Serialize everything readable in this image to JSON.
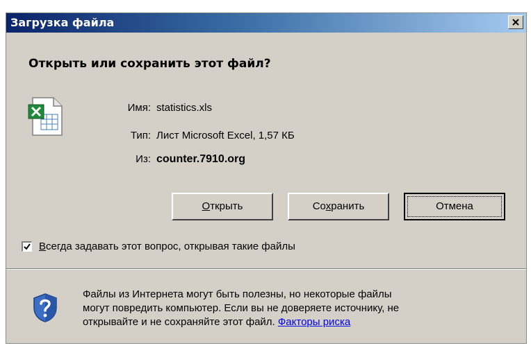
{
  "window": {
    "title": "Загрузка файла",
    "close_label": "Закрыть"
  },
  "heading": "Открыть или сохранить этот файл?",
  "file": {
    "icon": "excel-file-icon",
    "name_label": "Имя:",
    "name_value": "statistics.xls",
    "type_label": "Тип:",
    "type_value": "Лист Microsoft Excel, 1,57 КБ",
    "from_label": "Из:",
    "from_value": "counter.7910.org"
  },
  "buttons": {
    "open": {
      "mnemonic": "О",
      "rest": "ткрыть"
    },
    "save": {
      "before": "Со",
      "mnemonic": "х",
      "after": "ранить"
    },
    "cancel": "Отмена"
  },
  "checkbox": {
    "checked": true,
    "mnemonic": "В",
    "rest": "сегда задавать этот вопрос, открывая такие файлы"
  },
  "warning": {
    "icon": "security-shield-icon",
    "line1": "Файлы из Интернета могут быть полезны, но некоторые файлы",
    "line2": "могут повредить компьютер. Если вы не доверяете источнику, не",
    "line3": "открывайте и не сохраняйте этот файл.",
    "link": "Факторы риска"
  },
  "colors": {
    "dialog_bg": "#d4d0c8",
    "titlebar_start": "#0a246a",
    "titlebar_end": "#a6caf0",
    "link": "#0000ee"
  }
}
